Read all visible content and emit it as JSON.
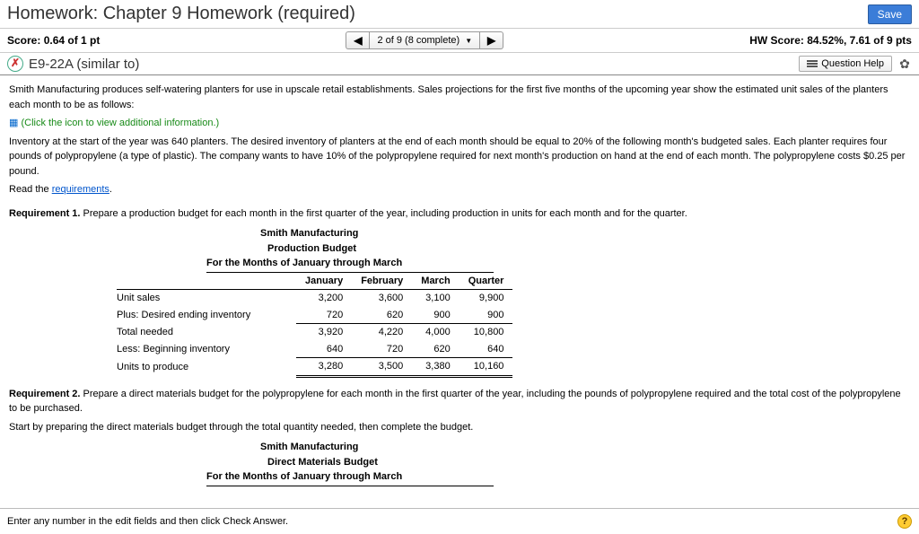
{
  "titlebar": {
    "title": "Homework: Chapter 9 Homework (required)",
    "save": "Save"
  },
  "scorebar": {
    "score_label": "Score:",
    "score_value": "0.64 of 1 pt",
    "progress": "2 of 9 (8 complete)",
    "hw_label": "HW Score:",
    "hw_value": "84.52%, 7.61 of 9 pts"
  },
  "questionbar": {
    "qid": "E9-22A (similar to)",
    "help": "Question Help"
  },
  "content": {
    "intro": "Smith Manufacturing produces self-watering planters for use in upscale retail establishments. Sales projections for the first five months of the upcoming year show the estimated unit sales of the planters each month to be as follows:",
    "icon_link": "(Click the icon to view additional information.)",
    "para2": "Inventory at the start of the year was 640 planters. The desired inventory of planters at the end of each month should be equal to 20% of the following month's budgeted sales. Each planter requires four pounds of polypropylene (a type of plastic). The company wants to have 10% of the polypropylene required for next month's production on hand at the end of each month. The polypropylene costs $0.25 per pound.",
    "read_the": "Read the ",
    "req_link": "requirements",
    "period": ".",
    "req1": "Requirement 1.",
    "req1_text": " Prepare a production budget for each month in the first quarter of the year, including production in units for each month and for the quarter.",
    "req2": "Requirement 2.",
    "req2_text": " Prepare a direct materials budget for the polypropylene for each month in the first quarter of the year, including the pounds of polypropylene required and the total cost of the polypropylene to be purchased.",
    "req2_start": "Start by preparing the direct materials budget through the total quantity needed, then complete the budget."
  },
  "budget1": {
    "company": "Smith Manufacturing",
    "title": "Production Budget",
    "period": "For the Months of January through March",
    "cols": [
      "January",
      "February",
      "March",
      "Quarter"
    ],
    "rows": {
      "unit_sales": {
        "label": "Unit sales",
        "vals": [
          "3,200",
          "3,600",
          "3,100",
          "9,900"
        ]
      },
      "plus": {
        "label": "Plus:   Desired ending inventory",
        "vals": [
          "720",
          "620",
          "900",
          "900"
        ]
      },
      "total_needed": {
        "label": "Total needed",
        "vals": [
          "3,920",
          "4,220",
          "4,000",
          "10,800"
        ]
      },
      "less": {
        "label": "Less:   Beginning inventory",
        "vals": [
          "640",
          "720",
          "620",
          "640"
        ]
      },
      "units": {
        "label": "Units to produce",
        "vals": [
          "3,280",
          "3,500",
          "3,380",
          "10,160"
        ]
      }
    }
  },
  "budget2": {
    "company": "Smith Manufacturing",
    "title": "Direct Materials Budget",
    "period": "For the Months of January through March"
  },
  "footer": {
    "hint": "Enter any number in the edit fields and then click Check Answer."
  }
}
